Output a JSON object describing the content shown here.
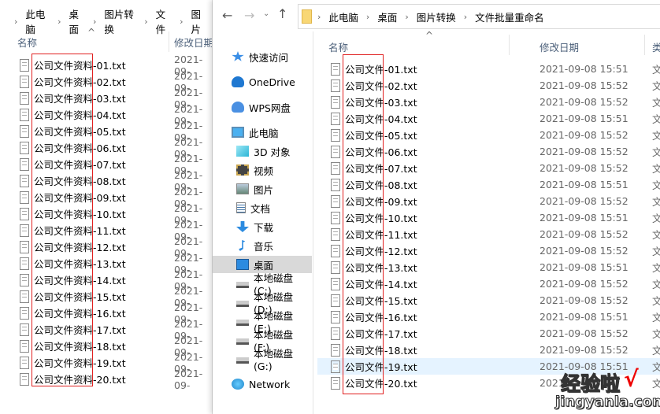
{
  "left_window": {
    "breadcrumb": [
      "此电脑",
      "桌面",
      "图片转换",
      "文件",
      "图片"
    ],
    "columns": {
      "name": "名称",
      "modified": "修改日期"
    },
    "files": [
      "公司文件资料-01.txt",
      "公司文件资料-02.txt",
      "公司文件资料-03.txt",
      "公司文件资料-04.txt",
      "公司文件资料-05.txt",
      "公司文件资料-06.txt",
      "公司文件资料-07.txt",
      "公司文件资料-08.txt",
      "公司文件资料-09.txt",
      "公司文件资料-10.txt",
      "公司文件资料-11.txt",
      "公司文件资料-12.txt",
      "公司文件资料-13.txt",
      "公司文件资料-14.txt",
      "公司文件资料-15.txt",
      "公司文件资料-16.txt",
      "公司文件资料-17.txt",
      "公司文件资料-18.txt",
      "公司文件资料-19.txt",
      "公司文件资料-20.txt"
    ],
    "date_prefix": "2021-09-"
  },
  "right_window": {
    "breadcrumb": [
      "此电脑",
      "桌面",
      "图片转换",
      "文件批量重命名"
    ],
    "columns": {
      "name": "名称",
      "modified": "修改日期",
      "type": "类"
    },
    "nav": [
      {
        "label": "快速访问",
        "icon": "star-icon",
        "level": 0
      },
      {
        "label": "OneDrive",
        "icon": "cloud-icon",
        "level": 0
      },
      {
        "label": "WPS网盘",
        "icon": "wps-cloud-icon",
        "level": 0
      },
      {
        "label": "此电脑",
        "icon": "computer-icon",
        "level": 0
      },
      {
        "label": "3D 对象",
        "icon": "cube-icon",
        "level": 1
      },
      {
        "label": "视频",
        "icon": "video-icon",
        "level": 1
      },
      {
        "label": "图片",
        "icon": "picture-icon",
        "level": 1
      },
      {
        "label": "文档",
        "icon": "document-icon",
        "level": 1
      },
      {
        "label": "下载",
        "icon": "download-icon",
        "level": 1
      },
      {
        "label": "音乐",
        "icon": "music-icon",
        "level": 1
      },
      {
        "label": "桌面",
        "icon": "desktop-icon",
        "level": 1,
        "selected": true
      },
      {
        "label": "本地磁盘 (C:)",
        "icon": "drive-icon",
        "level": 1
      },
      {
        "label": "本地磁盘 (D:)",
        "icon": "drive-icon",
        "level": 1
      },
      {
        "label": "本地磁盘 (E:)",
        "icon": "drive-icon",
        "level": 1
      },
      {
        "label": "本地磁盘 (F:)",
        "icon": "drive-icon",
        "level": 1
      },
      {
        "label": "本地磁盘 (G:)",
        "icon": "drive-icon",
        "level": 1
      },
      {
        "label": "Network",
        "icon": "network-icon",
        "level": 0
      }
    ],
    "files": [
      {
        "name": "公司文件-01.txt",
        "date": "2021-09-08 15:51",
        "type": "文"
      },
      {
        "name": "公司文件-02.txt",
        "date": "2021-09-08 15:52",
        "type": "文"
      },
      {
        "name": "公司文件-03.txt",
        "date": "2021-09-08 15:52",
        "type": "文"
      },
      {
        "name": "公司文件-04.txt",
        "date": "2021-09-08 15:51",
        "type": "文"
      },
      {
        "name": "公司文件-05.txt",
        "date": "2021-09-08 15:52",
        "type": "文"
      },
      {
        "name": "公司文件-06.txt",
        "date": "2021-09-08 15:52",
        "type": "文"
      },
      {
        "name": "公司文件-07.txt",
        "date": "2021-09-08 15:52",
        "type": "文"
      },
      {
        "name": "公司文件-08.txt",
        "date": "2021-09-08 15:51",
        "type": "文"
      },
      {
        "name": "公司文件-09.txt",
        "date": "2021-09-08 15:52",
        "type": "文"
      },
      {
        "name": "公司文件-10.txt",
        "date": "2021-09-08 15:51",
        "type": "文"
      },
      {
        "name": "公司文件-11.txt",
        "date": "2021-09-08 15:52",
        "type": "文"
      },
      {
        "name": "公司文件-12.txt",
        "date": "2021-09-08 15:52",
        "type": "文"
      },
      {
        "name": "公司文件-13.txt",
        "date": "2021-09-08 15:51",
        "type": "文"
      },
      {
        "name": "公司文件-14.txt",
        "date": "2021-09-08 15:52",
        "type": "文"
      },
      {
        "name": "公司文件-15.txt",
        "date": "2021-09-08 15:52",
        "type": "文"
      },
      {
        "name": "公司文件-16.txt",
        "date": "2021-09-08 15:51",
        "type": "文"
      },
      {
        "name": "公司文件-17.txt",
        "date": "2021-09-08 15:52",
        "type": "文"
      },
      {
        "name": "公司文件-18.txt",
        "date": "2021-09-08 15:52",
        "type": "文"
      },
      {
        "name": "公司文件-19.txt",
        "date": "2021-09-08 15:51",
        "type": "文",
        "hovered": true
      },
      {
        "name": "公司文件-20.txt",
        "date": "2021",
        "type": "文"
      }
    ]
  },
  "watermark": {
    "line1": "经验啦",
    "check": "√",
    "line2": "jingyanla.com"
  },
  "colors": {
    "highlight": "#e5f3ff",
    "selected": "#d9d9d9",
    "annotation": "#e02020",
    "header": "#4c607a"
  }
}
